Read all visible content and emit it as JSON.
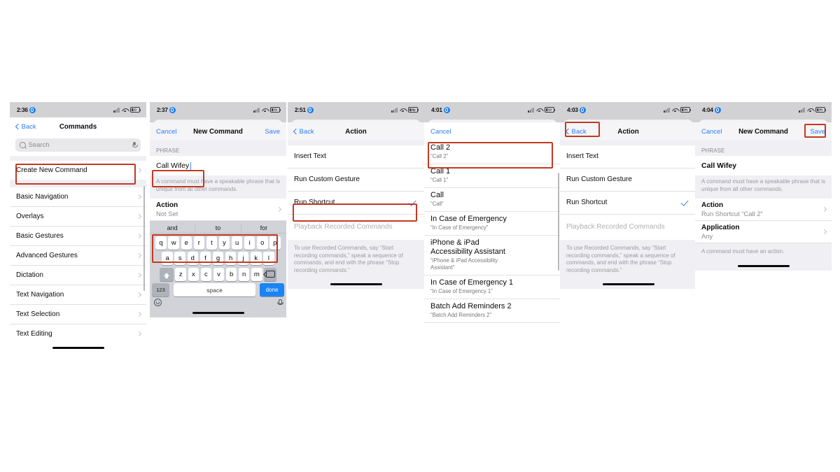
{
  "meta": {
    "accent_blue": "#2d7ff4",
    "highlight_red": "#c23a22",
    "background": "#ffffff"
  },
  "panels": [
    {
      "id": "commands-list",
      "status": {
        "time": "2:36",
        "battery": "50"
      },
      "nav": {
        "back": "Back",
        "title": "Commands"
      },
      "search": {
        "placeholder": "Search"
      },
      "create_new": "Create New Command",
      "categories": [
        "Basic Navigation",
        "Overlays",
        "Basic Gestures",
        "Advanced Gestures",
        "Dictation",
        "Text Navigation",
        "Text Selection",
        "Text Editing"
      ]
    },
    {
      "id": "new-command-keyboard",
      "status": {
        "time": "2:37",
        "battery": "60"
      },
      "nav": {
        "cancel": "Cancel",
        "title": "New Command",
        "save": "Save"
      },
      "section_header": "PHRASE",
      "phrase_value": "Call Wifey",
      "footnote": "A command must have a speakable phrase that is unique from all other commands.",
      "action": {
        "label": "Action",
        "value": "Not Set"
      },
      "keyboard": {
        "predictions": [
          "and",
          "to",
          "for"
        ],
        "row1": [
          "q",
          "w",
          "e",
          "r",
          "t",
          "y",
          "u",
          "i",
          "o",
          "p"
        ],
        "row2": [
          "a",
          "s",
          "d",
          "f",
          "g",
          "h",
          "j",
          "k",
          "l"
        ],
        "row3": [
          "z",
          "x",
          "c",
          "v",
          "b",
          "n",
          "m"
        ],
        "numbers_key": "123",
        "space_key": "space",
        "done_key": "done"
      }
    },
    {
      "id": "action-picker",
      "status": {
        "time": "2:51",
        "battery": "57"
      },
      "nav": {
        "back": "Back",
        "title": "Action"
      },
      "options": [
        {
          "label": "Insert Text",
          "checked": false,
          "disabled": false
        },
        {
          "label": "Run Custom Gesture",
          "checked": false,
          "disabled": false
        },
        {
          "label": "Run Shortcut",
          "checked": true,
          "disabled": false
        },
        {
          "label": "Playback Recorded Commands",
          "checked": false,
          "disabled": true
        }
      ],
      "footnote": "To use Recorded Commands, say “Start recording commands,” speak a sequence of commands, and end with the phrase “Stop recording commands.”"
    },
    {
      "id": "shortcut-picker",
      "status": {
        "time": "4:01",
        "battery": "65"
      },
      "nav": {
        "cancel": "Cancel"
      },
      "shortcuts": [
        {
          "title": "Call 2",
          "subtitle": "“Call 2”"
        },
        {
          "title": "Call 1",
          "subtitle": "“Call 1”"
        },
        {
          "title": "Call",
          "subtitle": "“Call”"
        },
        {
          "title": "In Case of Emergency",
          "subtitle": "“In Case of Emergency”"
        },
        {
          "title": "iPhone & iPad Accessibility Assistant",
          "subtitle": "“iPhone & iPad Accessibility Assistant”"
        },
        {
          "title": "In Case of Emergency 1",
          "subtitle": "“In Case of Emergency 1”"
        },
        {
          "title": "Batch Add Reminders 2",
          "subtitle": "“Batch Add Reminders 2”"
        }
      ]
    },
    {
      "id": "action-picker-back",
      "status": {
        "time": "4:03",
        "battery": "62"
      },
      "nav": {
        "back": "Back",
        "title": "Action"
      },
      "options": [
        {
          "label": "Insert Text",
          "checked": false,
          "disabled": false
        },
        {
          "label": "Run Custom Gesture",
          "checked": false,
          "disabled": false
        },
        {
          "label": "Run Shortcut",
          "checked": true,
          "disabled": false
        },
        {
          "label": "Playback Recorded Commands",
          "checked": false,
          "disabled": true
        }
      ],
      "footnote": "To use Recorded Commands, say “Start recording commands,” speak a sequence of commands, and end with the phrase “Stop recording commands.”"
    },
    {
      "id": "new-command-filled",
      "status": {
        "time": "4:04",
        "battery": "62"
      },
      "nav": {
        "cancel": "Cancel",
        "title": "New Command",
        "save": "Save"
      },
      "section_header": "PHRASE",
      "phrase_value": "Call Wifey",
      "footnote": "A command must have a speakable phrase that is unique from all other commands.",
      "action": {
        "label": "Action",
        "value": "Run Shortcut “Call 2”"
      },
      "application": {
        "label": "Application",
        "value": "Any"
      },
      "footnote2": "A command must have an action."
    }
  ]
}
